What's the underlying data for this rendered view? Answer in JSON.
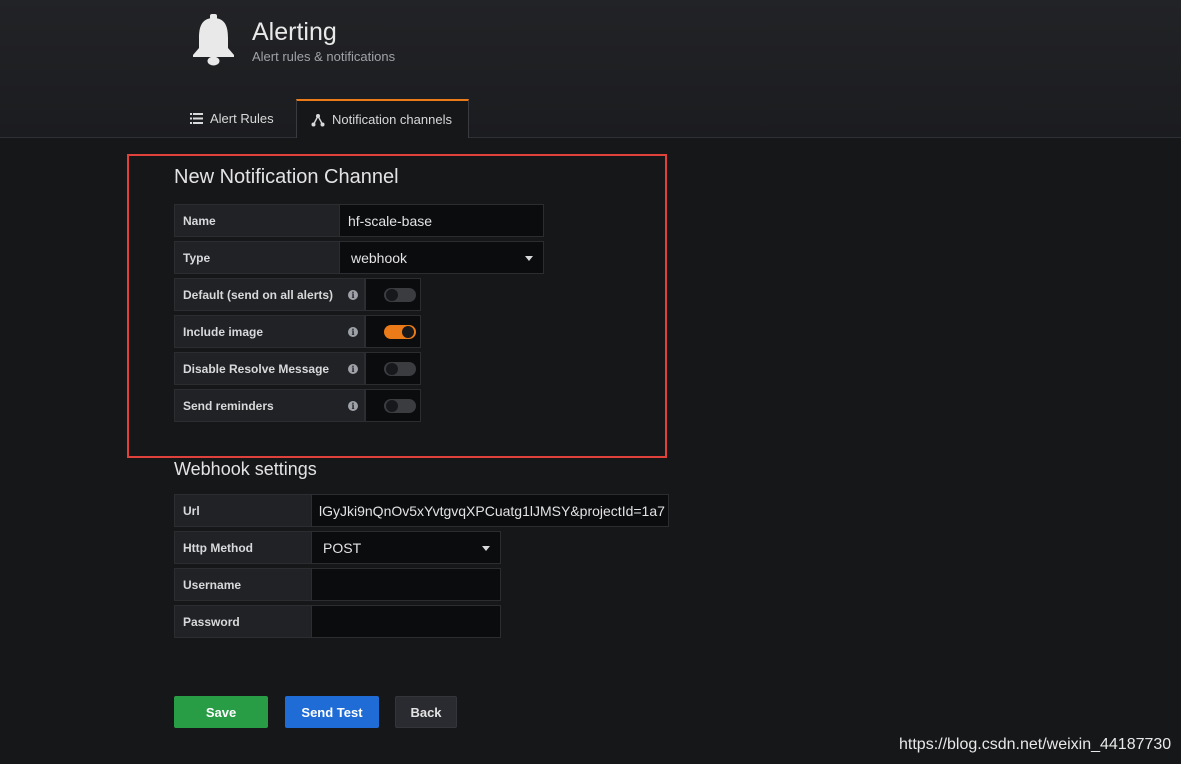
{
  "header": {
    "title": "Alerting",
    "subtitle": "Alert rules & notifications"
  },
  "tabs": [
    {
      "label": "Alert Rules",
      "icon": "list-icon",
      "active": false
    },
    {
      "label": "Notification channels",
      "icon": "network-icon",
      "active": true
    }
  ],
  "channel": {
    "heading": "New Notification Channel",
    "name_label": "Name",
    "name_value": "hf-scale-base",
    "type_label": "Type",
    "type_value": "webhook",
    "toggles": [
      {
        "label": "Default (send on all alerts)",
        "on": false
      },
      {
        "label": "Include image",
        "on": true
      },
      {
        "label": "Disable Resolve Message",
        "on": false
      },
      {
        "label": "Send reminders",
        "on": false
      }
    ],
    "info_glyph": "i"
  },
  "webhook": {
    "heading": "Webhook settings",
    "url_label": "Url",
    "url_value": "lGyJki9nQnOv5xYvtgvqXPCuatg1lJMSY&projectId=1a7",
    "method_label": "Http Method",
    "method_value": "POST",
    "username_label": "Username",
    "username_value": "",
    "password_label": "Password",
    "password_value": ""
  },
  "buttons": {
    "save": "Save",
    "send_test": "Send Test",
    "back": "Back"
  },
  "watermark": "https://blog.csdn.net/weixin_44187730",
  "colors": {
    "accent": "#eb7b18",
    "save": "#299c46",
    "send_test": "#1f6cd6",
    "highlight_box": "#e0413b"
  }
}
